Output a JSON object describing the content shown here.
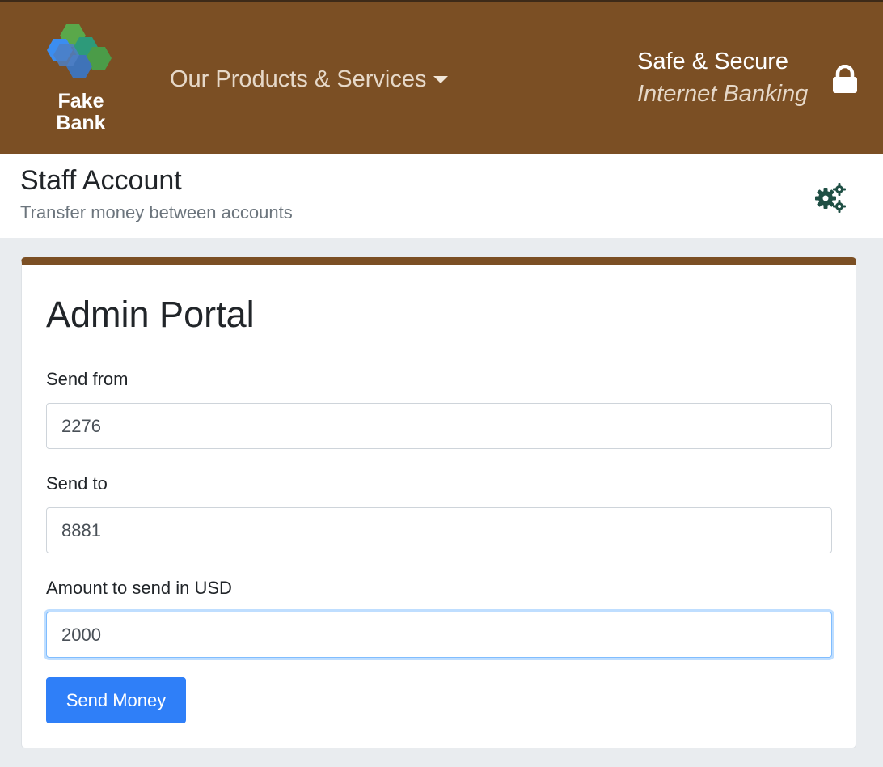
{
  "header": {
    "logo_text": [
      "Fake",
      "Bank"
    ],
    "nav_products_label": "Our Products & Services",
    "safe_line1": "Safe & Secure",
    "safe_line2": "Internet Banking",
    "lock_icon": "lock-icon",
    "brand_color": "#7b4f24"
  },
  "subheader": {
    "title": "Staff Account",
    "subtitle": "Transfer money between accounts",
    "settings_icon": "gears-icon"
  },
  "form": {
    "title": "Admin Portal",
    "send_from_label": "Send from",
    "send_from_value": "2276",
    "send_to_label": "Send to",
    "send_to_value": "8881",
    "amount_label": "Amount to send in USD",
    "amount_value": "2000",
    "submit_label": "Send Money",
    "accent_color": "#2f7ff8"
  }
}
